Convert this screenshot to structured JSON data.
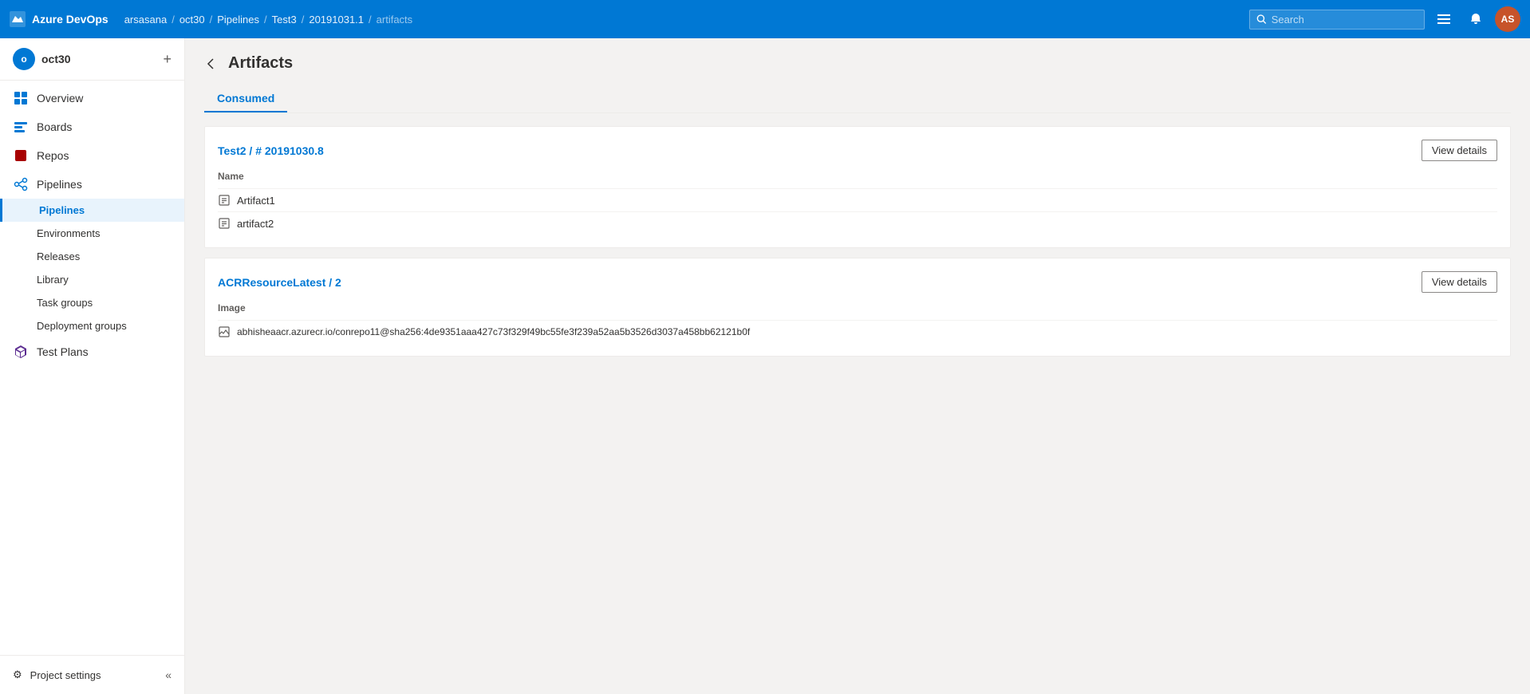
{
  "app": {
    "name": "Azure DevOps",
    "logo_text": "Azure DevOps"
  },
  "topbar": {
    "breadcrumbs": [
      "arsasana",
      "oct30",
      "Pipelines",
      "Test3",
      "20191031.1",
      "artifacts"
    ],
    "separators": [
      "/",
      "/",
      "/",
      "/",
      "/"
    ],
    "search_placeholder": "Search",
    "avatar_initials": "AS"
  },
  "sidebar": {
    "project_name": "oct30",
    "project_initial": "o",
    "nav_items": [
      {
        "id": "overview",
        "label": "Overview",
        "icon": "overview"
      },
      {
        "id": "boards",
        "label": "Boards",
        "icon": "boards"
      },
      {
        "id": "repos",
        "label": "Repos",
        "icon": "repos"
      },
      {
        "id": "pipelines",
        "label": "Pipelines",
        "icon": "pipelines"
      }
    ],
    "sub_nav_items": [
      {
        "id": "pipelines-sub",
        "label": "Pipelines",
        "active": true
      },
      {
        "id": "environments",
        "label": "Environments"
      },
      {
        "id": "releases",
        "label": "Releases"
      },
      {
        "id": "library",
        "label": "Library"
      },
      {
        "id": "task-groups",
        "label": "Task groups"
      },
      {
        "id": "deployment-groups",
        "label": "Deployment groups"
      }
    ],
    "bottom_items": [
      {
        "id": "test-plans",
        "label": "Test Plans",
        "icon": "test-plans"
      }
    ],
    "project_settings_label": "Project settings",
    "collapse_label": "Collapse"
  },
  "page": {
    "title": "Artifacts",
    "tabs": [
      {
        "id": "consumed",
        "label": "Consumed",
        "active": true
      }
    ]
  },
  "artifact_cards": [
    {
      "id": "card1",
      "title": "Test2 / # 20191030.8",
      "view_details_label": "View details",
      "col_header": "Name",
      "items": [
        {
          "id": "item1",
          "name": "Artifact1",
          "icon": "artifact"
        },
        {
          "id": "item2",
          "name": "artifact2",
          "icon": "artifact"
        }
      ]
    },
    {
      "id": "card2",
      "title": "ACRResourceLatest / 2",
      "view_details_label": "View details",
      "col_header": "Image",
      "items": [
        {
          "id": "item1",
          "name": "abhisheaacr.azurecr.io/conrepo11@sha256:4de9351aaa427c73f329f49bc55fe3f239a52aa5b3526d3037a458bb62121b0f",
          "icon": "image"
        }
      ]
    }
  ]
}
